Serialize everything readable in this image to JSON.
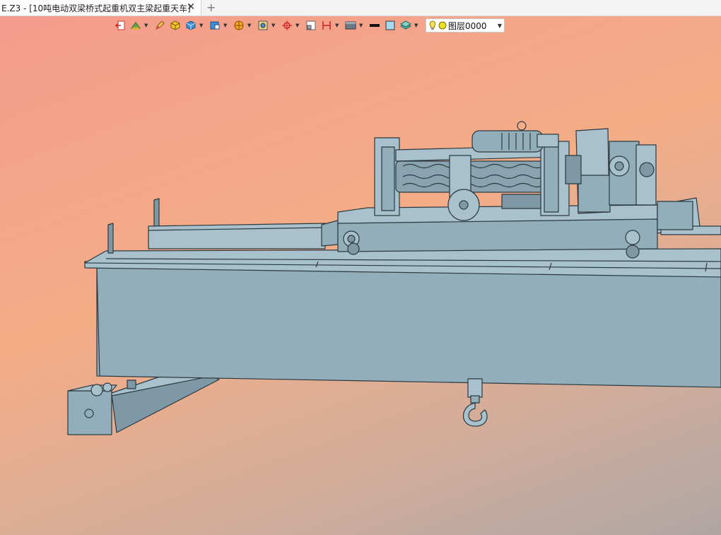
{
  "tab": {
    "title": "E.Z3 - [10吨电动双梁桥式起重机双主梁起重天车]",
    "close": "✕",
    "add": "+"
  },
  "toolbar": {
    "layer_value": "图层0000",
    "dropdown_glyph": "▼"
  },
  "colors": {
    "model_fill": "#93aebb",
    "model_stroke": "#2b3940",
    "bg_top": "#f49b8c",
    "bg_bottom": "#b0a6a4"
  }
}
